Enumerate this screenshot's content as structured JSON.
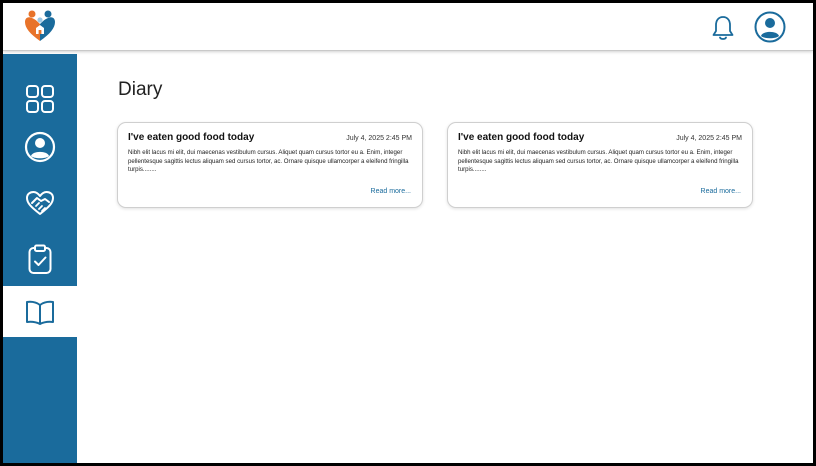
{
  "app": {
    "logo_icon": "family-heart-logo-icon"
  },
  "header": {
    "notification_icon": "bell-icon",
    "profile_icon": "user-circle-icon"
  },
  "sidebar": {
    "items": [
      {
        "icon": "dashboard-grid-icon",
        "active": false
      },
      {
        "icon": "user-circle-icon",
        "active": false
      },
      {
        "icon": "heart-handshake-icon",
        "active": false
      },
      {
        "icon": "clipboard-check-icon",
        "active": false
      },
      {
        "icon": "book-open-icon",
        "active": true
      }
    ]
  },
  "main": {
    "title": "Diary",
    "entries": [
      {
        "title": "I've eaten good food today",
        "date": "July 4, 2025 2:45 PM",
        "body": "Nibh elit lacus mi elit, dui maecenas vestibulum cursus. Aliquet quam cursus tortor eu a. Enim, integer pellentesque sagittis lectus aliquam sed cursus tortor, ac. Ornare quisque ullamcorper a eleifend fringilla turpis........",
        "more": "Read more..."
      },
      {
        "title": "I've eaten good food today",
        "date": "July 4, 2025 2:45 PM",
        "body": "Nibh elit lacus mi elit, dui maecenas vestibulum cursus. Aliquet quam cursus tortor eu a. Enim, integer pellentesque sagittis lectus aliquam sed cursus tortor, ac. Ornare quisque ullamcorper a eleifend fringilla turpis........",
        "more": "Read more..."
      }
    ]
  },
  "colors": {
    "sidebar": "#1a6b9c",
    "accent": "#1a6b9c",
    "logo_orange": "#e8732a",
    "logo_blue": "#1a6b9c"
  }
}
